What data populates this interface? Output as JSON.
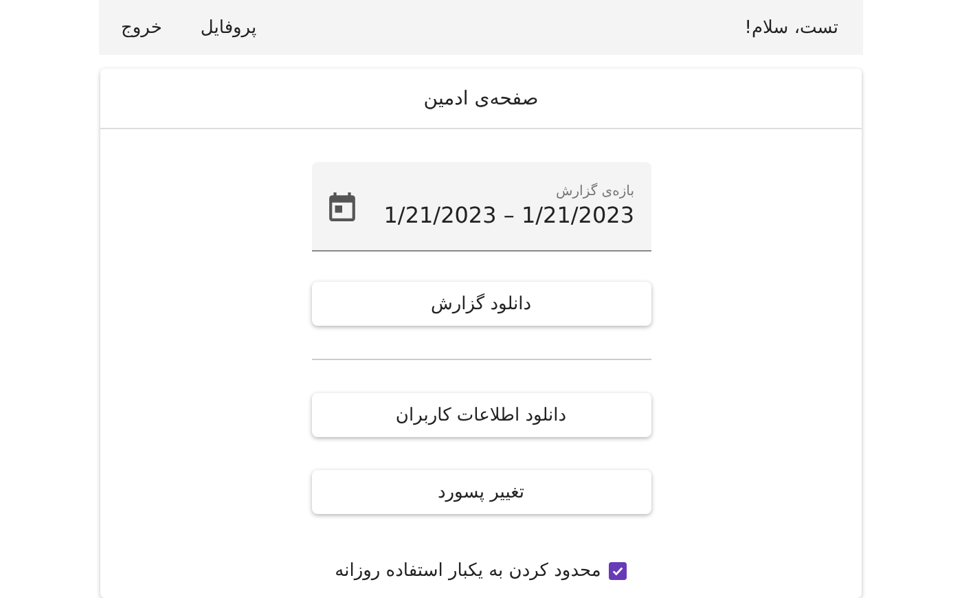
{
  "navbar": {
    "greeting": "تست، سلام!",
    "links": [
      {
        "label": "پروفایل"
      },
      {
        "label": "خروج"
      }
    ]
  },
  "card": {
    "title": "صفحه‌ی ادمین",
    "date_range": {
      "label": "بازه‌ی گزارش",
      "value": "1/21/2023 – 1/21/2023"
    },
    "report_button": "دانلود گزارش",
    "buttons": [
      "دانلود اطلاعات کاربران",
      "تغییر پسورد"
    ],
    "checkbox": {
      "label": "محدود کردن به یکبار استفاده روزانه",
      "checked": true
    }
  }
}
